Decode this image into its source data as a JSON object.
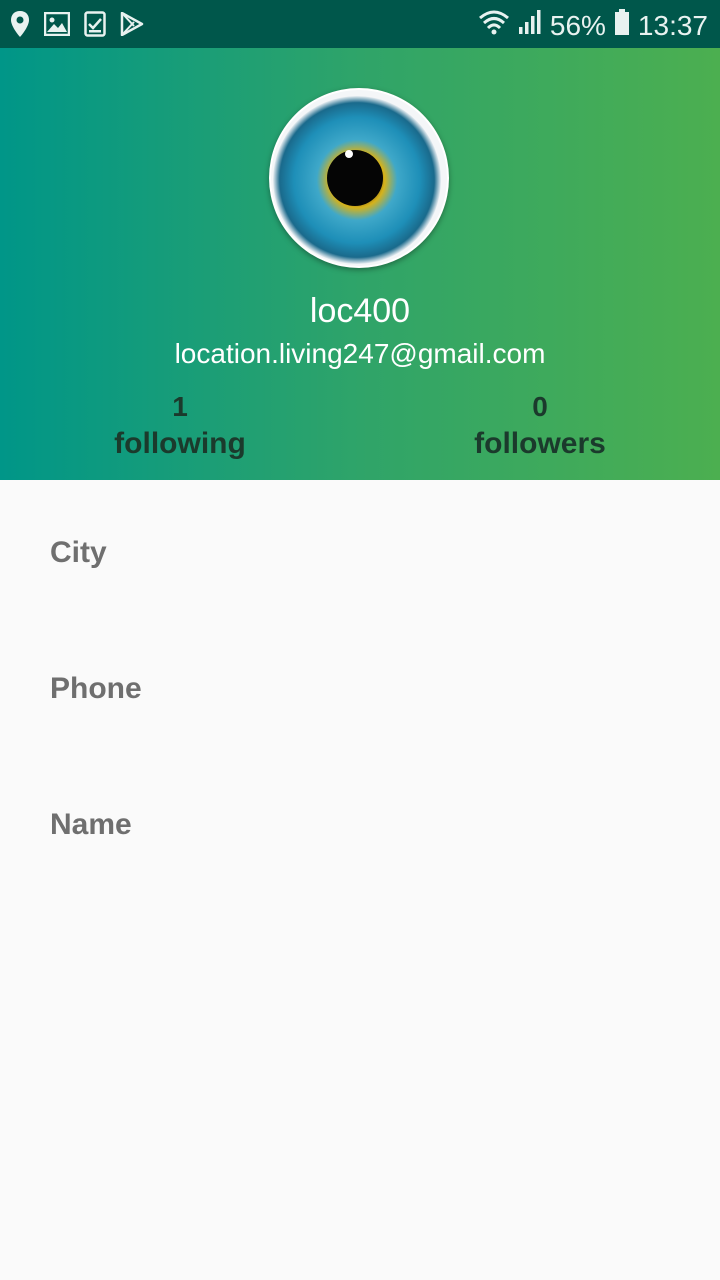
{
  "status_bar": {
    "battery": "56%",
    "time": "13:37",
    "icons": [
      "location-icon",
      "image-icon",
      "clipboard-check-icon",
      "play-store-icon",
      "wifi-icon",
      "signal-icon",
      "battery-icon"
    ]
  },
  "profile": {
    "username": "loc400",
    "email": "location.living247@gmail.com",
    "following_count": "1",
    "following_label": "following",
    "followers_count": "0",
    "followers_label": "followers"
  },
  "fields": {
    "city_label": "City",
    "phone_label": "Phone",
    "name_label": "Name"
  },
  "colors": {
    "status_bar": "#00574b",
    "header_start": "#009688",
    "header_end": "#4caf50",
    "stat_text": "#1b3a2c",
    "field_label": "#6f6f6f",
    "background": "#fafafa"
  }
}
